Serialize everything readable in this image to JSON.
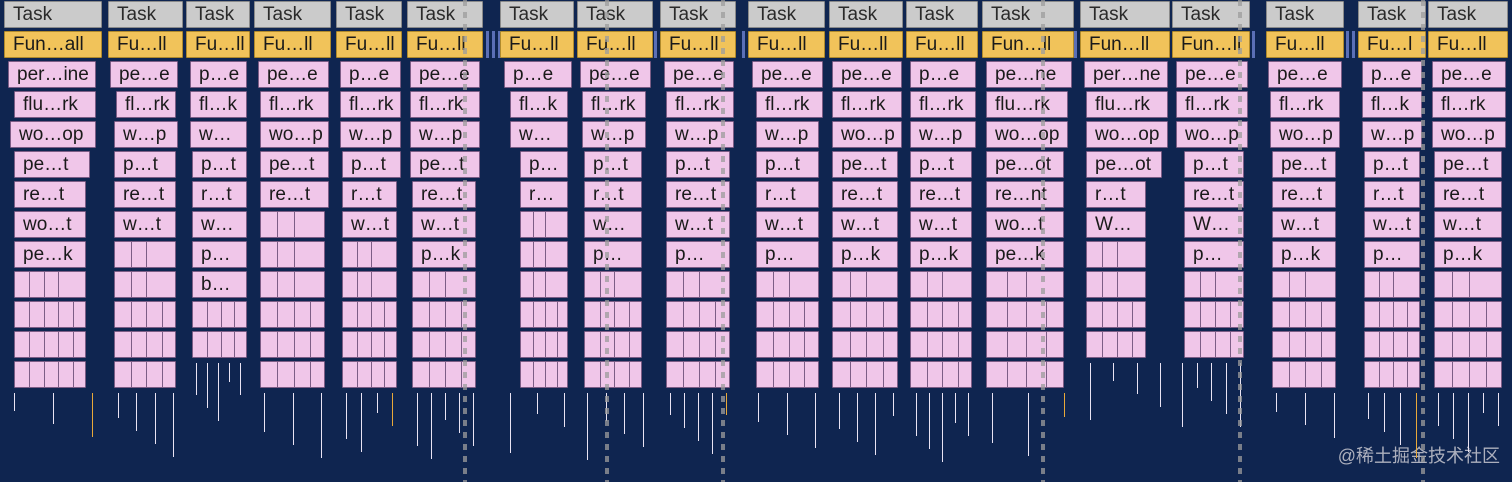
{
  "columns": [
    {
      "task": "Task",
      "fun": "Fun…all",
      "labels": [
        "per…ine",
        "flu…rk",
        "wo…op",
        "pe…t",
        "re…t",
        "wo…t",
        "pe…k"
      ]
    },
    {
      "task": "Task",
      "fun": "Fu…ll",
      "labels": [
        "pe…e",
        "fl…rk",
        "w…p",
        "p…t",
        "re…t",
        "w…t"
      ]
    },
    {
      "task": "Task",
      "fun": "Fu…ll",
      "labels": [
        "p…e",
        "fl…k",
        "w…",
        "p…t",
        "r…t",
        "w…",
        "p…",
        "b…"
      ]
    },
    {
      "task": "Task",
      "fun": "Fu…ll",
      "labels": [
        "pe…e",
        "fl…rk",
        "wo…p",
        "pe…t",
        "re…t"
      ]
    },
    {
      "task": "Task",
      "fun": "Fu…ll",
      "labels": [
        "p…e",
        "fl…rk",
        "w…p",
        "p…t",
        "r…t",
        "w…t"
      ]
    },
    {
      "task": "Task",
      "fun": "Fu…ll",
      "labels": [
        "pe…e",
        "fl…rk",
        "w…p",
        "pe…t",
        "re…t",
        "w…t",
        "p…k"
      ]
    },
    {
      "task": "Task",
      "fun": "Fu…ll",
      "labels": [
        "p…e",
        "fl…k",
        "w…",
        "p…",
        "r…"
      ]
    },
    {
      "task": "Task",
      "fun": "Fu…ll",
      "labels": [
        "pe…e",
        "fl…rk",
        "w…p",
        "p…t",
        "r…t",
        "w…",
        "p…"
      ]
    },
    {
      "task": "Task",
      "fun": "Fu…ll",
      "labels": [
        "pe…e",
        "fl…rk",
        "w…p",
        "p…t",
        "re…t",
        "w…t",
        "p…"
      ]
    },
    {
      "task": "Task",
      "fun": "Fu…ll",
      "labels": [
        "pe…e",
        "fl…rk",
        "w…p",
        "p…t",
        "r…t",
        "w…t",
        "p…"
      ]
    },
    {
      "task": "Task",
      "fun": "Fu…ll",
      "labels": [
        "pe…e",
        "fl…rk",
        "wo…p",
        "pe…t",
        "re…t",
        "w…t",
        "p…k"
      ]
    },
    {
      "task": "Task",
      "fun": "Fu…ll",
      "labels": [
        "p…e",
        "fl…rk",
        "w…p",
        "p…t",
        "re…t",
        "w…t",
        "p…k"
      ]
    },
    {
      "task": "Task",
      "fun": "Fun…ll",
      "labels": [
        "pe…ne",
        "flu…rk",
        "wo…op",
        "pe…ot",
        "re…nt",
        "wo…t",
        "pe…k"
      ]
    },
    {
      "task": "Task",
      "fun": "Fun…ll",
      "labels": [
        "per…ne",
        "flu…rk",
        "wo…op",
        "pe…ot",
        "r…t",
        "W…"
      ]
    },
    {
      "task": "Task",
      "fun": "Fun…ll",
      "labels": [
        "pe…e",
        "fl…rk",
        "wo…p",
        "p…t",
        "re…t",
        "W…",
        "p…"
      ]
    },
    {
      "task": "Task",
      "fun": "Fu…ll",
      "labels": [
        "pe…e",
        "fl…rk",
        "wo…p",
        "pe…t",
        "re…t",
        "w…t",
        "p…k"
      ]
    },
    {
      "task": "Task",
      "fun": "Fu…l",
      "labels": [
        "p…e",
        "fl…k",
        "w…p",
        "p…t",
        "r…t",
        "w…t",
        "p…"
      ]
    },
    {
      "task": "Task",
      "fun": "Fu…ll",
      "labels": [
        "pe…e",
        "fl…rk",
        "wo…p",
        "pe…t",
        "re…t",
        "w…t",
        "p…k"
      ]
    }
  ],
  "watermark": "@稀土掘金技术社区",
  "colors": {
    "background": "#0f2550",
    "task": "#cbcbcb",
    "function": "#f1c35a",
    "frame": "#f0c6e9",
    "tick": "#e9e3f3",
    "tick_orange": "#e8a93a"
  }
}
